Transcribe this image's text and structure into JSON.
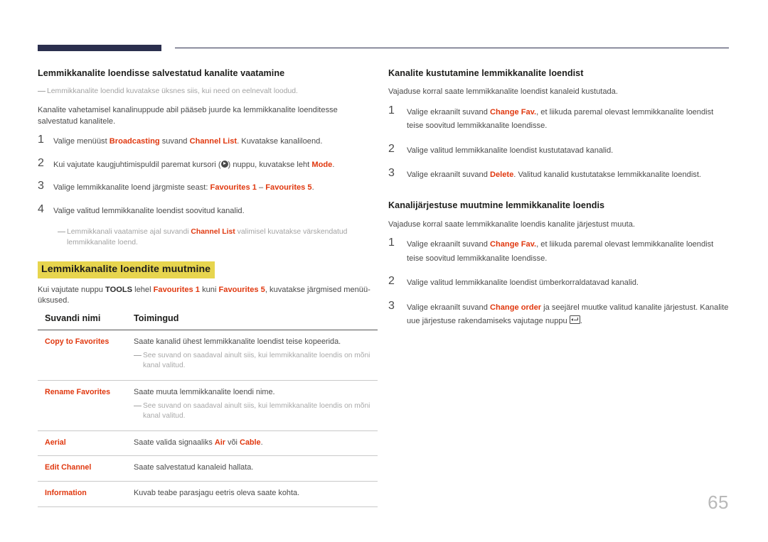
{
  "page": {
    "number": "65"
  },
  "header": {
    "rule_color": "#2b2f4e"
  },
  "accent_color": "#E0380F",
  "highlight_color": "#E7D54E",
  "left_column": {
    "section1": {
      "heading": "Lemmikkanalite loendisse salvestatud kanalite vaatamine",
      "note": "Lemmikkanalite loendid kuvatakse üksnes siis, kui need on eelnevalt loodud.",
      "intro": "Kanalite vahetamisel kanalinuppude abil pääseb juurde ka lemmikkanalite loenditesse salvestatud kanalitele.",
      "steps": [
        {
          "num": "1",
          "pre": "Valige menüüst ",
          "acc1": "Broadcasting",
          "mid": " suvand ",
          "acc2": "Channel List",
          "post": ". Kuvatakse kanaliloend."
        },
        {
          "num": "2",
          "pre": "Kui vajutate kaugjuhtimispuldil paremat kursori (",
          "icon": "cursor-right-icon",
          "mid": ") nuppu, kuvatakse leht ",
          "acc1": "Mode",
          "post": "."
        },
        {
          "num": "3",
          "pre": "Valige lemmikkanalite loend järgmiste seast: ",
          "acc1": "Favourites 1",
          "mid": " – ",
          "acc2": "Favourites 5",
          "post": "."
        },
        {
          "num": "4",
          "pre": "Valige valitud lemmikkanalite loendist soovitud kanalid.",
          "post": ""
        }
      ],
      "step_note": {
        "pre": "Lemmikkanali vaatamise ajal suvandi ",
        "acc1": "Channel List",
        "post": " valimisel kuvatakse värskendatud lemmikkanalite loend."
      }
    },
    "section2": {
      "heading": "Lemmikkanalite loendite muutmine",
      "intro": {
        "pre": "Kui vajutate nuppu ",
        "bold1": "TOOLS",
        "mid1": " lehel ",
        "acc1": "Favourites 1",
        "mid2": " kuni ",
        "acc2": "Favourites 5",
        "post": ", kuvatakse järgmised menüü-üksused."
      },
      "table": {
        "headers": [
          "Suvandi nimi",
          "Toimingud"
        ],
        "rows": [
          {
            "option": "Copy to Favorites",
            "desc": "Saate kanalid ühest lemmikkanalite loendist teise kopeerida.",
            "note": "See suvand on saadaval ainult siis, kui lemmikkanalite loendis on mõni kanal valitud."
          },
          {
            "option": "Rename Favorites",
            "desc": "Saate muuta lemmikkanalite loendi nime.",
            "note": "See suvand on saadaval ainult siis, kui lemmikkanalite loendis on mõni kanal valitud."
          },
          {
            "option": "Aerial",
            "desc_pre": "Saate valida signaaliks ",
            "desc_acc1": "Air",
            "desc_mid": " või ",
            "desc_acc2": "Cable",
            "desc_post": ".",
            "note": ""
          },
          {
            "option": "Edit Channel",
            "desc": "Saate salvestatud kanaleid hallata.",
            "note": ""
          },
          {
            "option": "Information",
            "desc": "Kuvab teabe parasjagu eetris oleva saate kohta.",
            "note": ""
          }
        ]
      }
    }
  },
  "right_column": {
    "section1": {
      "heading": "Kanalite kustutamine lemmikkanalite loendist",
      "intro": "Vajaduse korral saate lemmikkanalite loendist kanaleid kustutada.",
      "steps": [
        {
          "num": "1",
          "pre": "Valige ekraanilt suvand ",
          "acc1": "Change Fav.",
          "post": ", et liikuda paremal olevast lemmikkanalite loendist teise soovitud lemmikkanalite loendisse."
        },
        {
          "num": "2",
          "pre": "Valige valitud lemmikkanalite loendist kustutatavad kanalid.",
          "post": ""
        },
        {
          "num": "3",
          "pre": "Valige ekraanilt suvand ",
          "acc1": "Delete",
          "post": ". Valitud kanalid kustutatakse lemmikkanalite loendist."
        }
      ]
    },
    "section2": {
      "heading": "Kanalijärjestuse muutmine lemmikkanalite loendis",
      "intro": "Vajaduse korral saate lemmikkanalite loendis kanalite järjestust muuta.",
      "steps": [
        {
          "num": "1",
          "pre": "Valige ekraanilt suvand ",
          "acc1": "Change Fav.",
          "post": ", et liikuda paremal olevast lemmikkanalite loendist teise soovitud lemmikkanalite loendisse."
        },
        {
          "num": "2",
          "pre": "Valige valitud lemmikkanalite loendist ümberkorraldatavad kanalid.",
          "post": ""
        },
        {
          "num": "3",
          "pre": "Valige ekraanilt suvand ",
          "acc1": "Change order",
          "mid": " ja seejärel muutke valitud kanalite järjestust. Kanalite uue järjestuse rakendamiseks vajutage nuppu ",
          "icon": "enter-key-icon",
          "post": "."
        }
      ]
    }
  }
}
